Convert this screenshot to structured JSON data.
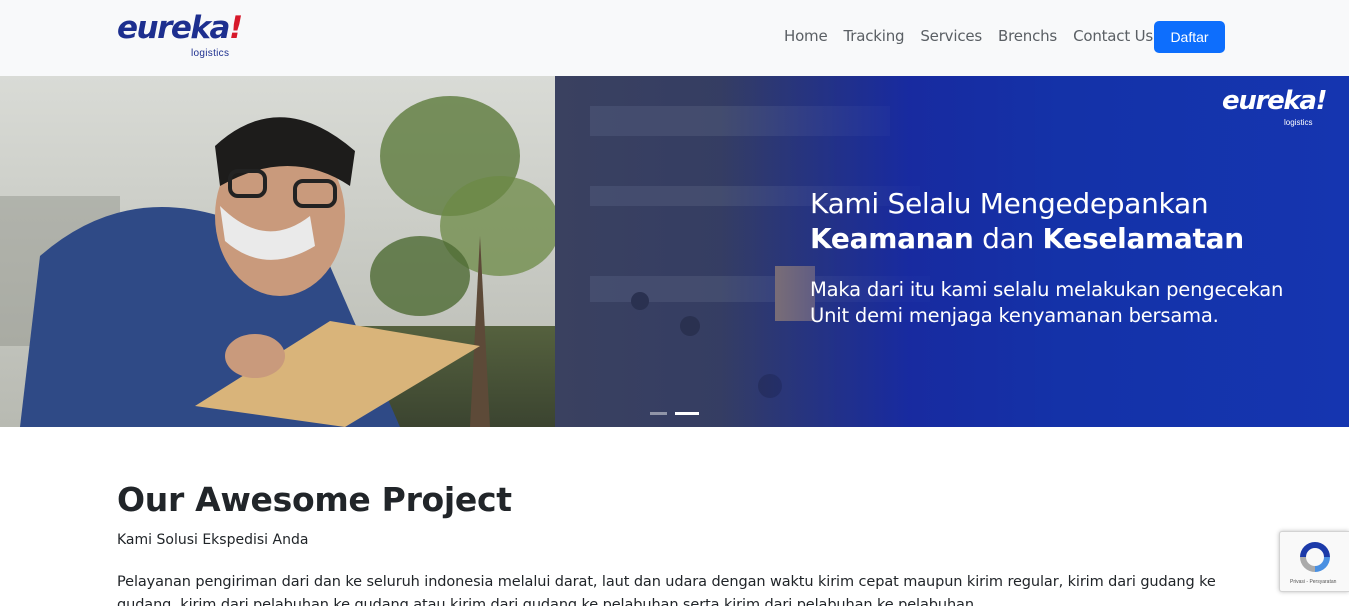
{
  "brand": {
    "name": "eureka",
    "mark": "!",
    "tagline": "logistics"
  },
  "nav": {
    "items": [
      {
        "label": "Home"
      },
      {
        "label": "Tracking"
      },
      {
        "label": "Services"
      },
      {
        "label": "Brenchs"
      },
      {
        "label": "Contact Us"
      }
    ],
    "cta_label": "Daftar"
  },
  "hero": {
    "logo_name": "eureka",
    "logo_mark": "!",
    "logo_tagline": "logistics",
    "headline_line1": "Kami Selalu Mengedepankan",
    "headline_bold1": "Keamanan",
    "headline_mid": " dan ",
    "headline_bold2": "Keselamatan",
    "text_line1": "Maka dari itu kami selalu melakukan pengecekan",
    "text_line2": "Unit demi menjaga kenyamanan bersama.",
    "slides_count": 2,
    "active_slide": 2
  },
  "section": {
    "title": "Our Awesome Project",
    "subtitle": "Kami Solusi Ekspedisi Anda",
    "body": "Pelayanan pengiriman dari dan ke seluruh indonesia melalui darat, laut dan udara dengan waktu kirim cepat maupun kirim regular, kirim dari gudang ke gudang, kirim dari pelabuhan ke gudang atau kirim dari gudang ke pelabuhan serta kirim dari pelabuhan ke pelabuhan."
  },
  "recaptcha": {
    "footer": "Privasi - Persyaratan"
  },
  "colors": {
    "primary": "#0d6efd",
    "brand_blue": "#1d2f8f",
    "brand_red": "#d7192a",
    "hero_blue": "#1432a8"
  }
}
